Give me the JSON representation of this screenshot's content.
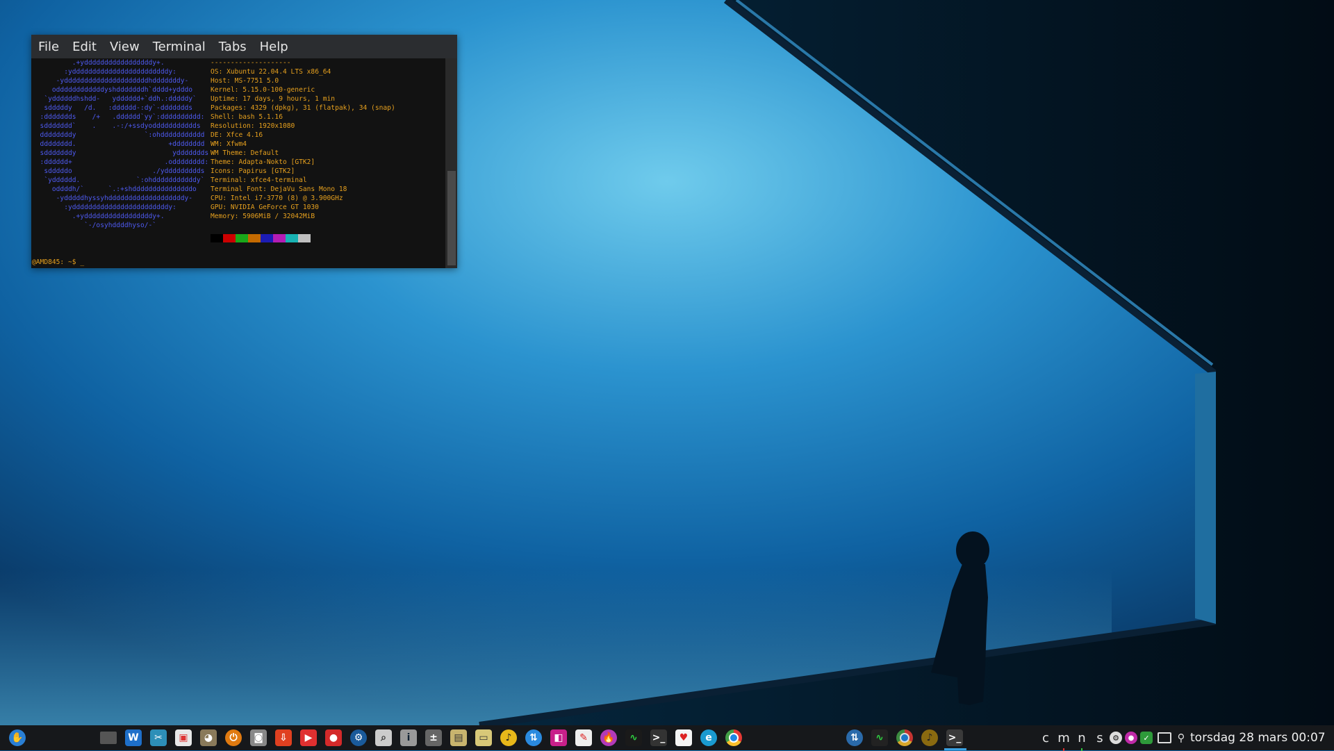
{
  "terminal": {
    "menu": [
      "File",
      "Edit",
      "View",
      "Terminal",
      "Tabs",
      "Help"
    ],
    "logo_lines": [
      "          .+ydddddddddddddddddy+.",
      "        :yddddddddddddddddddddddddy:",
      "      -ydddddddddddddddddddddhdddddddy-",
      "     oddddddddddddyshdddddddh`dddd+ydddo",
      "   `yddddddhshdd-   ydddddd+`ddh.:dddddy`",
      "   sdddddy   /d.   :dddddd-:dy`-ddddddds",
      "  :ddddddds    /+   .dddddd`yy`:dddddddddd:",
      "  sddddddd`    .    .-:/+ssdyoddddddddddds",
      "  ddddddddy                 `:ohddddddddddd",
      "  dddddddd.                       +dddddddd",
      "  sdddddddy                        yddddddds",
      "  :dddddd+                       .odddddddd:",
      "   sdddddo                    ./yddddddddds",
      "   `ydddddd.              `:ohdddddddddddy`",
      "     oddddh/`      `.:+shdddddddddddddddo",
      "      -ydddddhyssyhdddddddddddddddddddy-",
      "        :yddddddddddddddddddddddddy:",
      "          .+ydddddddddddddddddy+.",
      "             `-/osyhddddhyso/-`"
    ],
    "info_separator": "--------------------",
    "info": [
      {
        "key": "OS",
        "value": "Xubuntu 22.04.4 LTS x86_64"
      },
      {
        "key": "Host",
        "value": "MS-7751 5.0"
      },
      {
        "key": "Kernel",
        "value": "5.15.0-100-generic"
      },
      {
        "key": "Uptime",
        "value": "17 days, 9 hours, 1 min"
      },
      {
        "key": "Packages",
        "value": "4329 (dpkg), 31 (flatpak), 34 (snap)"
      },
      {
        "key": "Shell",
        "value": "bash 5.1.16"
      },
      {
        "key": "Resolution",
        "value": "1920x1080"
      },
      {
        "key": "DE",
        "value": "Xfce 4.16"
      },
      {
        "key": "WM",
        "value": "Xfwm4"
      },
      {
        "key": "WM Theme",
        "value": "Default"
      },
      {
        "key": "Theme",
        "value": "Adapta-Nokto [GTK2]"
      },
      {
        "key": "Icons",
        "value": "Papirus [GTK2]"
      },
      {
        "key": "Terminal",
        "value": "xfce4-terminal"
      },
      {
        "key": "Terminal Font",
        "value": "DejaVu Sans Mono 18"
      },
      {
        "key": "CPU",
        "value": "Intel i7-3770 (8) @ 3.900GHz"
      },
      {
        "key": "GPU",
        "value": "NVIDIA GeForce GT 1030"
      },
      {
        "key": "Memory",
        "value": "5906MiB / 32042MiB"
      }
    ],
    "palette": [
      "#000000",
      "#cc0000",
      "#1aa81a",
      "#c46a00",
      "#1c1cb4",
      "#b41cb4",
      "#18b2b2",
      "#bfbfbf"
    ],
    "prompt": "@AMD845: ~$ ",
    "cursor": "_"
  },
  "taskbar": {
    "tray_letters": [
      "c",
      "m",
      "n",
      "s"
    ],
    "clock": "torsdag 28 mars 00:07"
  }
}
